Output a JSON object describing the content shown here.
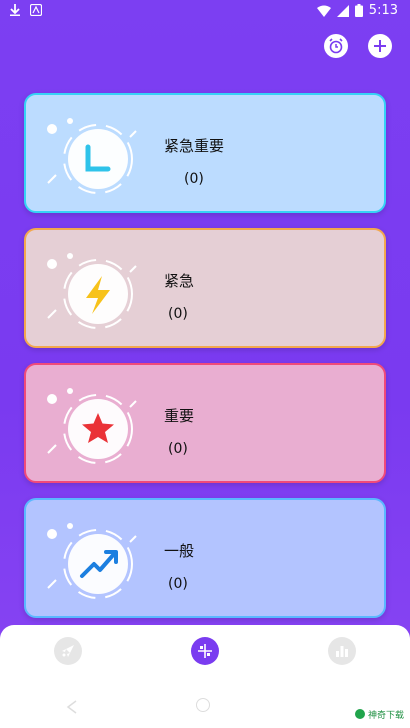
{
  "status_bar": {
    "time": "5:13",
    "icons": [
      "download-icon",
      "app-notification-icon",
      "wifi-icon",
      "signal-icon",
      "battery-icon"
    ]
  },
  "top_actions": [
    {
      "icon": "alarm-clock-icon"
    },
    {
      "icon": "plus-icon"
    }
  ],
  "cards": [
    {
      "title": "紧急重要",
      "count": "(0)",
      "icon": "clock-icon",
      "bg": "#bcdcff",
      "border": "#36d2f5"
    },
    {
      "title": "紧急",
      "count": "(0)",
      "icon": "lightning-icon",
      "bg": "#e5cfd5",
      "border": "#f2a74e"
    },
    {
      "title": "重要",
      "count": "(0)",
      "icon": "star-icon",
      "bg": "#e9aed1",
      "border": "#f04a7a"
    },
    {
      "title": "一般",
      "count": "(0)",
      "icon": "trend-up-icon",
      "bg": "#b3c4ff",
      "border": "#5ab8ff"
    }
  ],
  "bottom_nav": {
    "items": [
      {
        "icon": "rocket-icon",
        "active": false
      },
      {
        "icon": "quadrant-icon",
        "active": true
      },
      {
        "icon": "bar-chart-icon",
        "active": false
      }
    ]
  },
  "watermark": {
    "text": "神奇下载"
  },
  "colors": {
    "accent": "#7a3cf0"
  }
}
